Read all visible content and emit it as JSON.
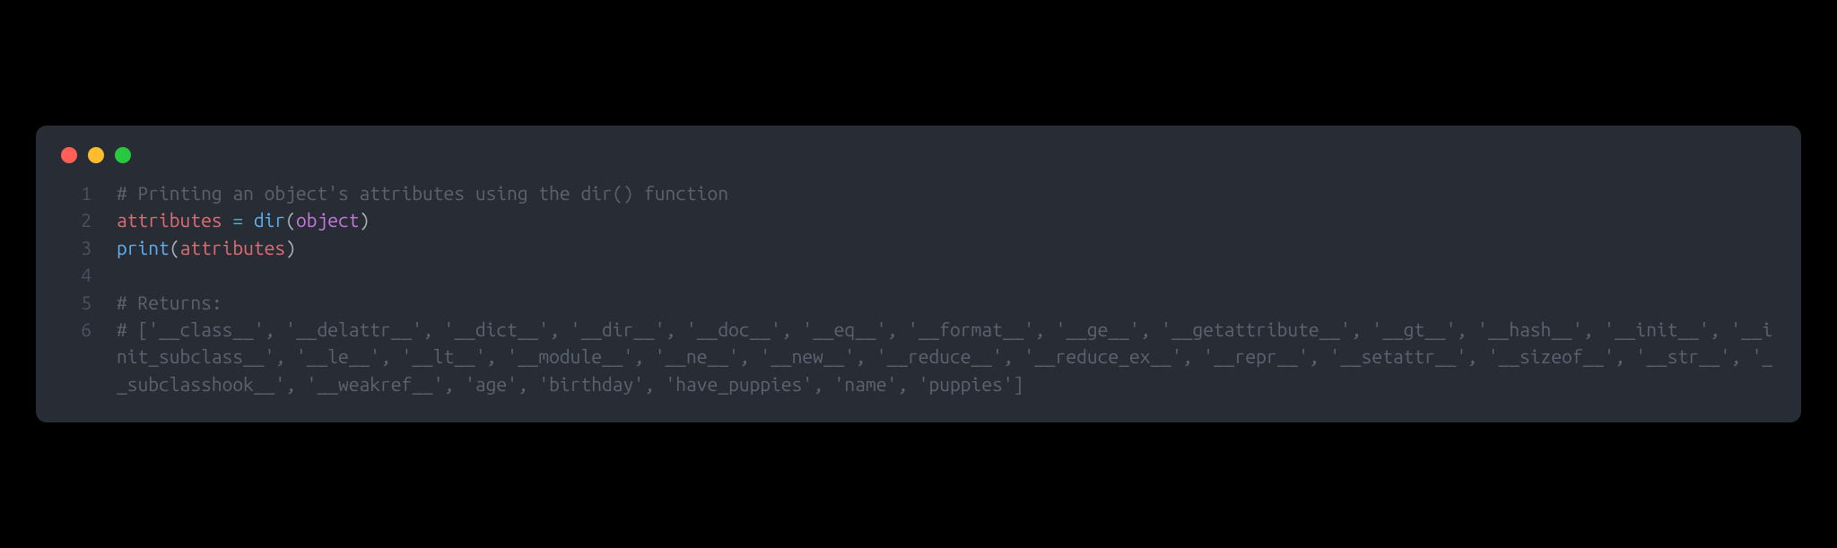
{
  "window": {
    "traffic_lights": [
      "red",
      "yellow",
      "green"
    ]
  },
  "code": {
    "lines": [
      {
        "num": "1",
        "tokens": [
          {
            "cls": "tok-comment",
            "text": "# Printing an object's attributes using the dir() function"
          }
        ]
      },
      {
        "num": "2",
        "tokens": [
          {
            "cls": "tok-ident",
            "text": "attributes"
          },
          {
            "cls": "tok-punct",
            "text": " "
          },
          {
            "cls": "tok-op",
            "text": "="
          },
          {
            "cls": "tok-punct",
            "text": " "
          },
          {
            "cls": "tok-func",
            "text": "dir"
          },
          {
            "cls": "tok-punct",
            "text": "("
          },
          {
            "cls": "tok-builtin",
            "text": "object"
          },
          {
            "cls": "tok-punct",
            "text": ")"
          }
        ]
      },
      {
        "num": "3",
        "tokens": [
          {
            "cls": "tok-func",
            "text": "print"
          },
          {
            "cls": "tok-punct",
            "text": "("
          },
          {
            "cls": "tok-ident",
            "text": "attributes"
          },
          {
            "cls": "tok-punct",
            "text": ")"
          }
        ]
      },
      {
        "num": "4",
        "tokens": []
      },
      {
        "num": "5",
        "tokens": [
          {
            "cls": "tok-comment",
            "text": "# Returns:"
          }
        ]
      },
      {
        "num": "6",
        "tokens": [
          {
            "cls": "tok-comment",
            "text": "# ['__class__', '__delattr__', '__dict__', '__dir__', '__doc__', '__eq__', '__format__', '__ge__', '__getattribute__', '__gt__', '__hash__', '__init__', '__init_subclass__', '__le__', '__lt__', '__module__', '__ne__', '__new__', '__reduce__', '__reduce_ex__', '__repr__', '__setattr__', '__sizeof__', '__str__', '__subclasshook__', '__weakref__', 'age', 'birthday', 'have_puppies', 'name', 'puppies']"
          }
        ]
      }
    ]
  }
}
